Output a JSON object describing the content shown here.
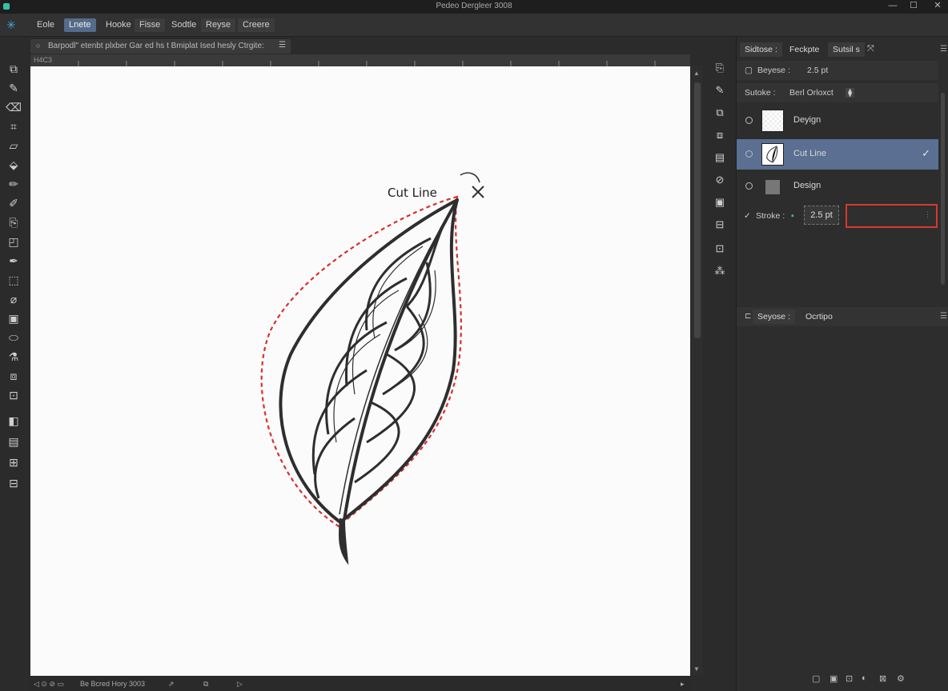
{
  "window": {
    "title": "Pedeo Dergleer 3008",
    "minimize": "—",
    "maximize": "☐",
    "close": "✕"
  },
  "menu": {
    "logo": "✳",
    "items": [
      "Eole",
      "Lnete",
      "Hooke",
      "Fisse",
      "Sodtle",
      "Reyse",
      "Creere"
    ]
  },
  "docbar": {
    "text": "Barpodl\" etenbt plxber Gar ed hs t Bmiplat Ised hesly Ctrgite:",
    "menu": "☰"
  },
  "ruler": {
    "label": "H4C3"
  },
  "canvas": {
    "cut_label": "Cut Line"
  },
  "status": {
    "zoom": "◁  ⊙ ⊘  ▭",
    "doc": "Be Bcred Hory 3003",
    "arrow": "▷"
  },
  "panel": {
    "tabs": [
      "Sidtose :",
      "Feckpte",
      "Sutsil s"
    ],
    "row1": {
      "label": "Beyese :",
      "value": "2.5 pt"
    },
    "row2": {
      "label": "Sutoke :",
      "value": "Berl Orloxct"
    },
    "layers": [
      {
        "name": "Deyign"
      },
      {
        "name": "Cut Line",
        "check": "✓"
      },
      {
        "name": "Design"
      }
    ],
    "stroke": {
      "label": "Stroke :",
      "value": "2.5 pt"
    },
    "bottom_tabs": [
      "Seyose :",
      "Ocrtipo"
    ]
  }
}
